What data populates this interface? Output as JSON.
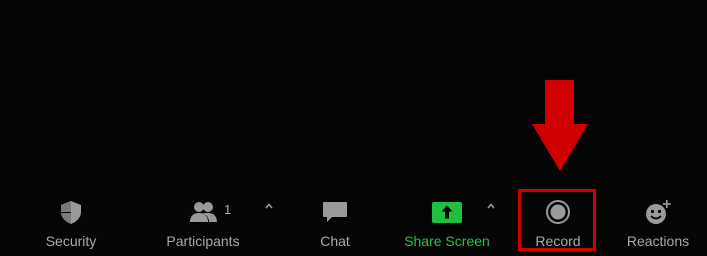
{
  "toolbar": {
    "security": {
      "label": "Security",
      "icon": "shield-icon"
    },
    "participants": {
      "label": "Participants",
      "count": "1",
      "icon": "participants-icon"
    },
    "chat": {
      "label": "Chat",
      "icon": "chat-bubble-icon"
    },
    "share_screen": {
      "label": "Share Screen",
      "icon": "share-screen-icon"
    },
    "record": {
      "label": "Record",
      "icon": "record-icon"
    },
    "reactions": {
      "label": "Reactions",
      "icon": "emoji-plus-icon"
    }
  },
  "annotation": {
    "highlight_target": "Record",
    "arrow_icon": "down-arrow-icon",
    "color": "#d10000"
  },
  "colors": {
    "background": "#050505",
    "label": "#a9a9a9",
    "share_accent": "#1fbf3f"
  }
}
